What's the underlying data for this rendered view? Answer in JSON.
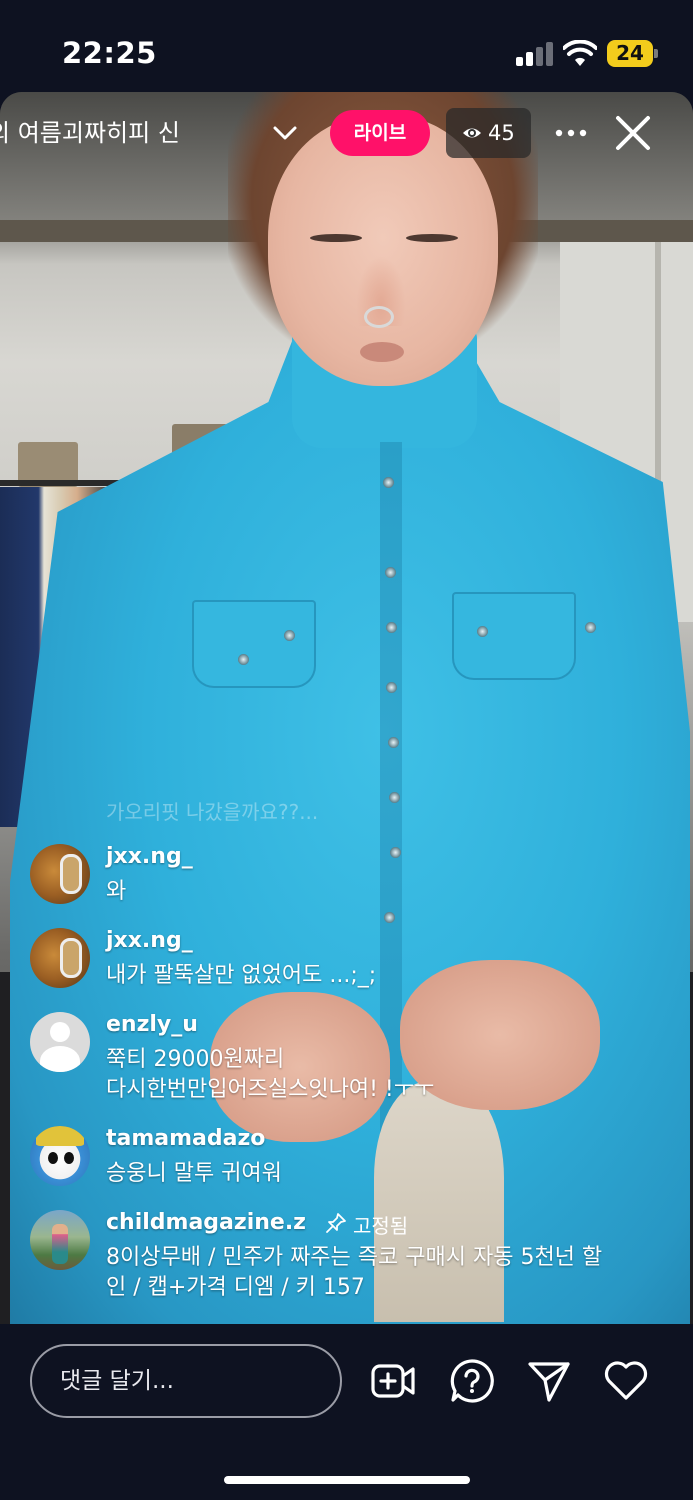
{
  "status_bar": {
    "time": "22:25",
    "battery": "24"
  },
  "header": {
    "broadcast_title": "의 여름괴짜히피 신",
    "live_label": "라이브",
    "viewer_count": "45"
  },
  "comments": {
    "faded_text": "가오리핏 나갔을까요??...",
    "items": [
      {
        "username": "jxx.ng_",
        "text": "와"
      },
      {
        "username": "jxx.ng_",
        "text": "내가 팔뚝살만 없었어도 ...;_;"
      },
      {
        "username": "enzly_u",
        "text_line1": "쭉티 29000원짜리",
        "text_line2": "다시한번만입어즈실스잇나여! !ㅜㅜ"
      },
      {
        "username": "tamamadazo",
        "text": "승웅니 말투 귀여워"
      },
      {
        "username": "childmagazine.z",
        "pinned_label": "고정됨",
        "text_line1": "8이상무배 / 민주가 짜주는 즉코 구매시 자동 5천넌 할",
        "text_line2": "인 / 캡+가격 디엠 / 키 157"
      }
    ]
  },
  "bottom_bar": {
    "comment_placeholder": "댓글 달기..."
  },
  "colors": {
    "live_badge": "#ff1169",
    "background": "#0e1221",
    "battery": "#f3cc1c"
  },
  "icons": [
    "signal-icon",
    "wifi-icon",
    "battery-icon",
    "chevron-down-icon",
    "eye-icon",
    "more-icon",
    "close-icon",
    "pin-icon",
    "video-add-icon",
    "question-icon",
    "send-icon",
    "heart-icon"
  ]
}
